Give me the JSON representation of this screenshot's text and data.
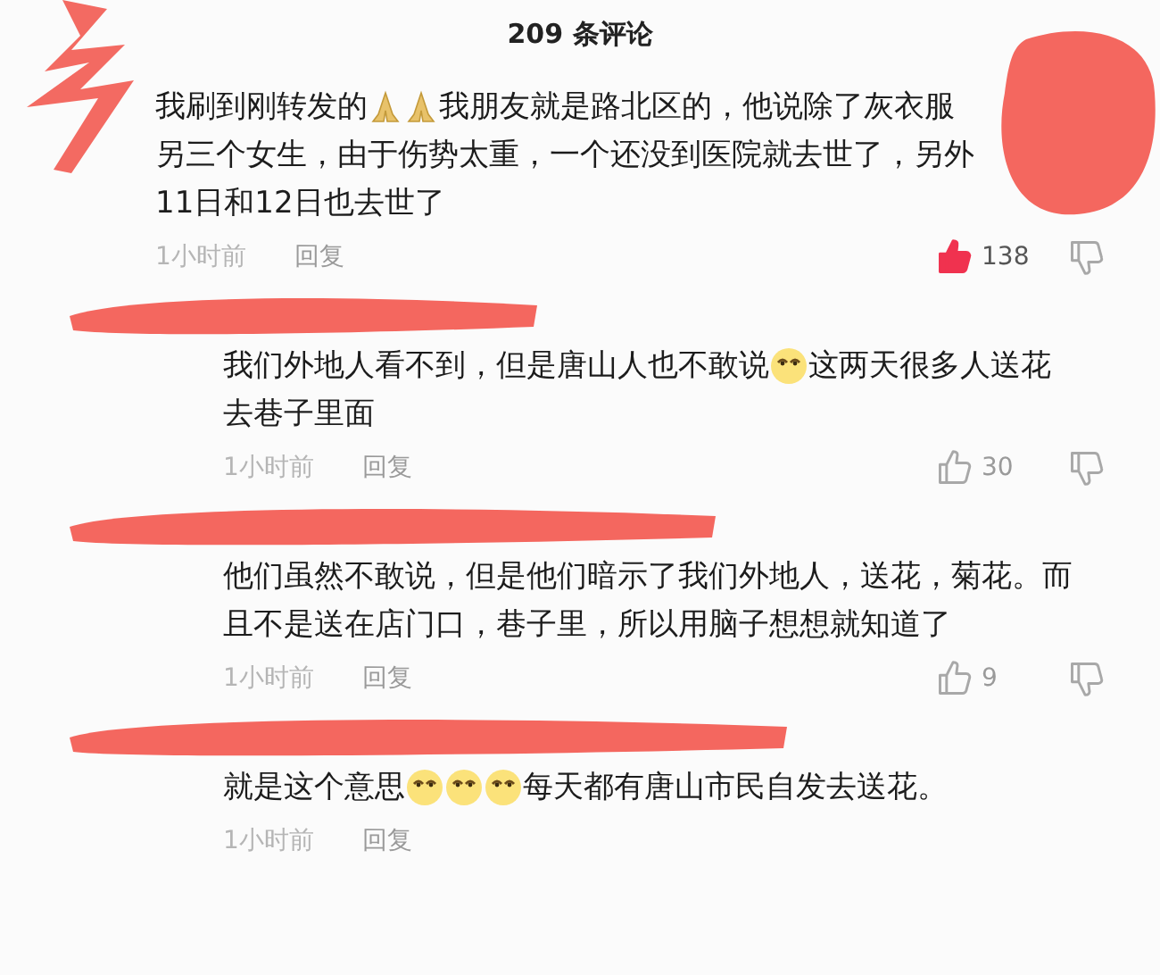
{
  "header": {
    "title": "209 条评论"
  },
  "comments": [
    {
      "reply": false,
      "lines": [
        [
          {
            "kind": "text",
            "text": "我刷到刚转发的"
          },
          {
            "kind": "pray"
          },
          {
            "kind": "pray"
          },
          {
            "kind": "text",
            "text": "我朋友就是路北区的，他说除了灰衣服"
          }
        ],
        [
          {
            "kind": "text",
            "text": "另三个女生，由于伤势太重，一个还没到医院就去世了，另外"
          }
        ],
        [
          {
            "kind": "text",
            "text": "11日和12日也去世了"
          }
        ]
      ],
      "time": "1小时前",
      "reply_label": "回复",
      "likes": "138",
      "liked": true
    },
    {
      "reply": true,
      "lines": [
        [
          {
            "kind": "text",
            "text": "我们外地人看不到，但是唐山人也不敢说"
          },
          {
            "kind": "squint"
          },
          {
            "kind": "text",
            "text": "这两天很多人送花"
          }
        ],
        [
          {
            "kind": "text",
            "text": "去巷子里面"
          }
        ]
      ],
      "time": "1小时前",
      "reply_label": "回复",
      "likes": "30",
      "liked": false
    },
    {
      "reply": true,
      "lines": [
        [
          {
            "kind": "text",
            "text": "他们虽然不敢说，但是他们暗示了我们外地人，送花，菊花。而"
          }
        ],
        [
          {
            "kind": "text",
            "text": "且不是送在店门口，巷子里，所以用脑子想想就知道了"
          }
        ]
      ],
      "time": "1小时前",
      "reply_label": "回复",
      "likes": "9",
      "liked": false
    },
    {
      "reply": true,
      "lines": [
        [
          {
            "kind": "text",
            "text": "就是这个意思"
          },
          {
            "kind": "squint"
          },
          {
            "kind": "squint"
          },
          {
            "kind": "squint"
          },
          {
            "kind": "text",
            "text": "每天都有唐山市民自发去送花。"
          }
        ]
      ],
      "time": "1小时前",
      "reply_label": "回复"
    }
  ]
}
